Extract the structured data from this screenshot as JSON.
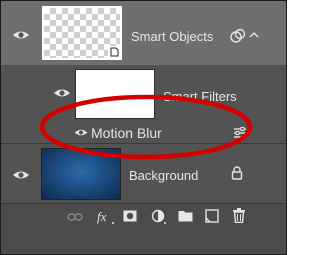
{
  "layers": {
    "smart_object": {
      "name": "Smart Objects"
    },
    "smart_filters": {
      "name": "Smart Filters"
    },
    "filter": {
      "name": "Motion Blur"
    },
    "background": {
      "name": "Background"
    }
  },
  "colors": {
    "panel": "#535353",
    "selected": "#6e6e6e",
    "highlight_ring": "#d40000",
    "text": "#e6e6e6"
  },
  "footer_icons": [
    "link-icon",
    "fx-icon",
    "mask-icon",
    "adjustment-icon",
    "folder-icon",
    "new-layer-icon",
    "trash-icon"
  ]
}
